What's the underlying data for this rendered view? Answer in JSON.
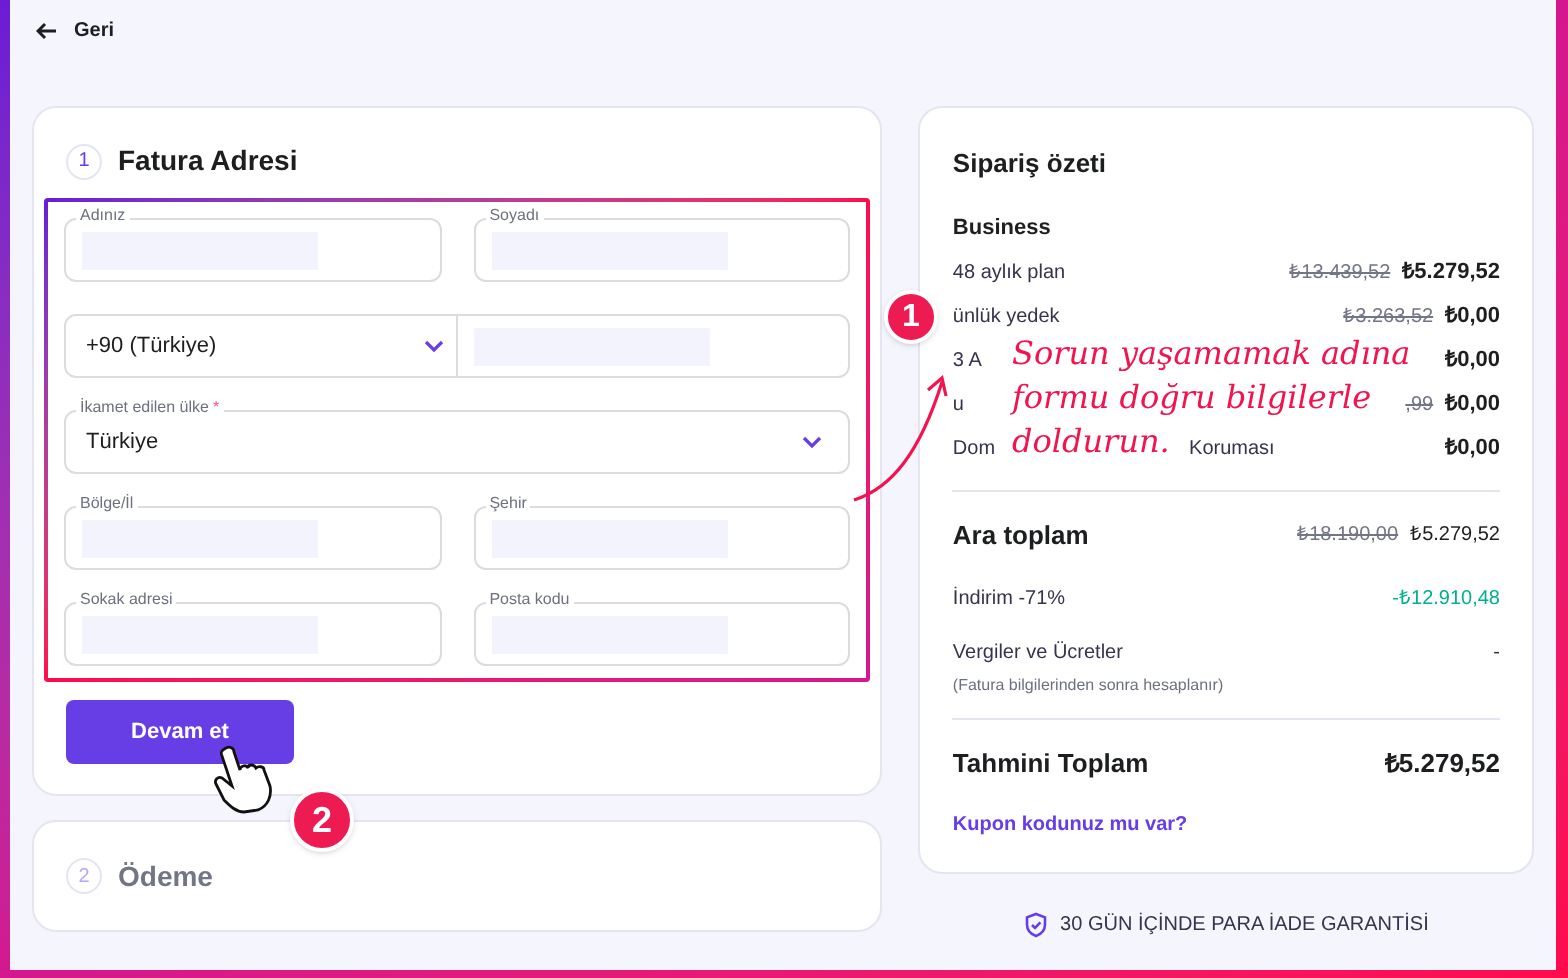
{
  "back_link": {
    "label": "Geri"
  },
  "billing": {
    "step": "1",
    "title": "Fatura Adresi",
    "expanded": true,
    "fields": [
      {
        "kind": "text",
        "label": "Adınız"
      },
      {
        "kind": "text",
        "label": "Soyadı"
      },
      {
        "kind": "phone",
        "code": "+90 (Türkiye)"
      },
      {
        "kind": "select",
        "label": "İkamet edilen ülke",
        "required_mark": "*",
        "value": "Türkiye"
      },
      {
        "kind": "text",
        "label": "Bölge/İl"
      },
      {
        "kind": "text",
        "label": "Şehir"
      },
      {
        "kind": "text",
        "label": "Sokak adresi"
      },
      {
        "kind": "text",
        "label": "Posta kodu"
      }
    ],
    "button": "Devam et"
  },
  "payment": {
    "step": "2",
    "title": "Ödeme",
    "expanded": false
  },
  "summary": {
    "title": "Sipariş özeti",
    "plan": "Business",
    "items": [
      {
        "label": "48 aylık plan",
        "old_price": "₺13.439,52",
        "price": "₺5.279,52"
      },
      {
        "label": "ünlük yedek",
        "old_price": "₺3.263,52",
        "price": "₺0,00"
      },
      {
        "label": "3 A",
        "price": "₺0,00"
      },
      {
        "label": "u",
        "old_price": ",99",
        "price": "₺0,00"
      },
      {
        "label": "Dom",
        "label_2": "Koruması",
        "price": "₺0,00"
      }
    ],
    "subtotal": {
      "label": "Ara toplam",
      "old_price": "₺18.190,00",
      "price": "₺5.279,52"
    },
    "discount": {
      "label": "İndirim -71%",
      "value": "-₺12.910,48"
    },
    "taxes": {
      "label": "Vergiler ve Ücretler",
      "note": "(Fatura bilgilerinden sonra hesaplanır)",
      "value": "-"
    },
    "total": {
      "label": "Tahmini Toplam",
      "value": "₺5.279,52"
    },
    "coupon_link": "Kupon kodunuz mu var?"
  },
  "guarantee": "30 GÜN İÇİNDE PARA İADE GARANTİSİ",
  "annotations": {
    "note_lines": [
      "Sorun yaşamamak adına",
      "formu doğru bilgilerle",
      "doldurun."
    ],
    "badges": [
      "1",
      "2"
    ]
  }
}
